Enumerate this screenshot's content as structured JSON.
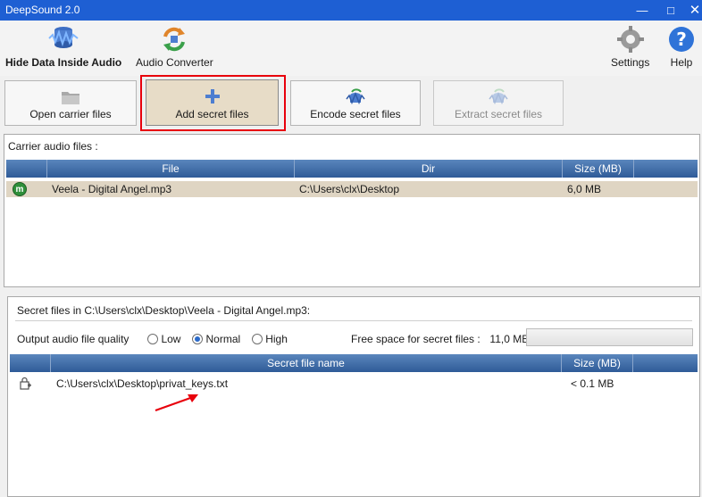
{
  "window": {
    "title": "DeepSound 2.0",
    "min_glyph": "—",
    "max_glyph": "□",
    "close_glyph": "✕"
  },
  "menubar": {
    "hide_data_label": "Hide Data Inside Audio",
    "audio_converter_label": "Audio Converter",
    "settings_label": "Settings",
    "help_label": "Help"
  },
  "toolbar": {
    "open_carrier_label": "Open carrier files",
    "add_secret_label": "Add secret files",
    "encode_secret_label": "Encode secret files",
    "extract_secret_label": "Extract secret files"
  },
  "carrier": {
    "title": "Carrier audio files :",
    "columns": {
      "file": "File",
      "dir": "Dir",
      "size": "Size (MB)"
    },
    "rows": [
      {
        "icon_letter": "m",
        "file": "Veela - Digital Angel.mp3",
        "dir": "C:\\Users\\clx\\Desktop",
        "size": "6,0 MB"
      }
    ]
  },
  "secret": {
    "title": "Secret files in C:\\Users\\clx\\Desktop\\Veela - Digital Angel.mp3:",
    "quality_label": "Output audio file quality",
    "quality_options": [
      "Low",
      "Normal",
      "High"
    ],
    "quality_selected": "Normal",
    "free_space_label": "Free space for secret files :",
    "free_space_value": "11,0 MB",
    "free_space_used_fraction": 0.0,
    "columns": {
      "name": "Secret file name",
      "size": "Size (MB)"
    },
    "rows": [
      {
        "name": "C:\\Users\\clx\\Desktop\\privat_keys.txt",
        "size": "< 0.1 MB"
      }
    ]
  },
  "colors": {
    "titlebar": "#1e5fd3",
    "grid_header": "#3f6ea8",
    "selected_row": "#dfd5c3",
    "highlight_box": "#e8000c",
    "arrow": "#e8000c"
  }
}
